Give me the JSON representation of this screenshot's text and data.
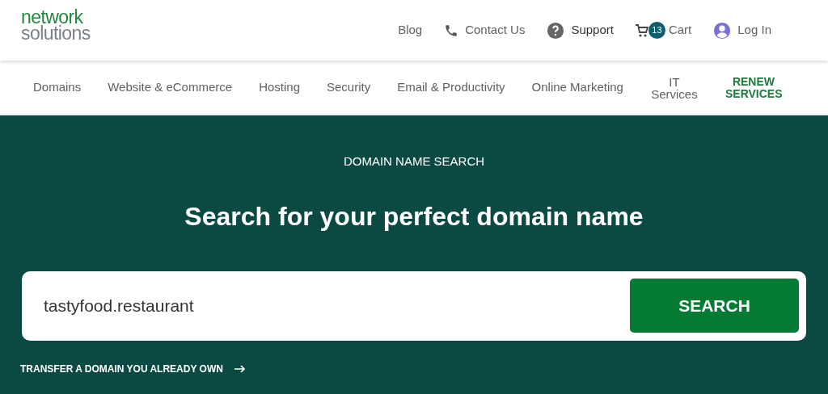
{
  "logo": {
    "line1": "network",
    "line2": "solutions"
  },
  "top_links": [
    {
      "kind": "plain",
      "label": "Blog"
    },
    {
      "kind": "phone",
      "label": "Contact Us"
    },
    {
      "kind": "help",
      "label": "Support"
    },
    {
      "kind": "cart",
      "label": "Cart",
      "badge": "13"
    },
    {
      "kind": "user",
      "label": "Log In"
    }
  ],
  "nav": [
    {
      "label": "Domains",
      "highlighted": false
    },
    {
      "label": "Website & eCommerce",
      "highlighted": false
    },
    {
      "label": "Hosting",
      "highlighted": false
    },
    {
      "label": "Security",
      "highlighted": false
    },
    {
      "label": "Email & Productivity",
      "highlighted": false
    },
    {
      "label": "Online Marketing",
      "highlighted": false
    },
    {
      "label": "IT Services",
      "highlighted": false
    },
    {
      "label": "RENEW SERVICES",
      "highlighted": true
    }
  ],
  "hero": {
    "eyebrow": "DOMAIN NAME SEARCH",
    "heading": "Search for your perfect domain name",
    "search_value": "tastyfood.restaurant",
    "search_button": "SEARCH",
    "transfer_link": "TRANSFER A DOMAIN YOU ALREADY OWN"
  }
}
